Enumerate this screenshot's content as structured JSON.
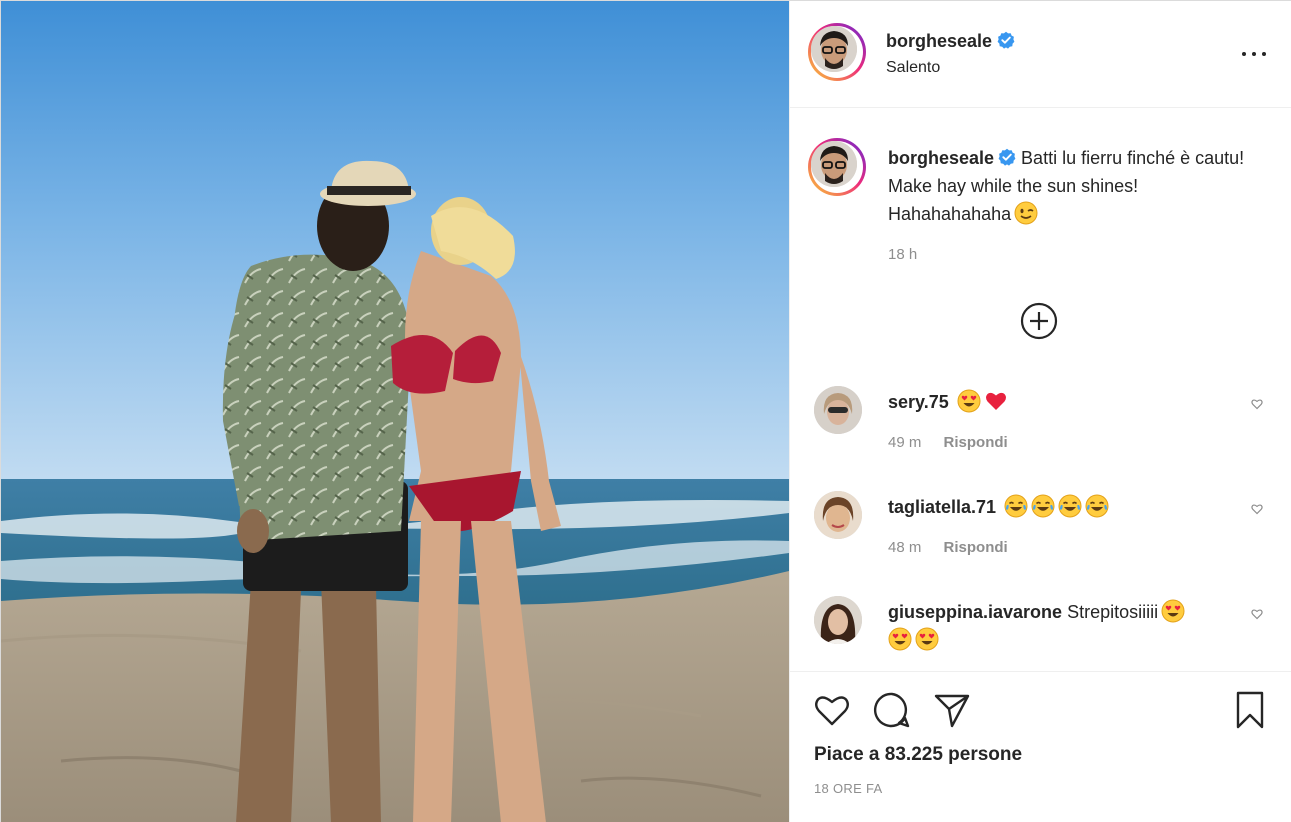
{
  "post": {
    "author": {
      "username": "borgheseale",
      "location": "Salento",
      "verified_icon": "verified-badge-icon"
    },
    "caption": {
      "text": "Batti lu fierru finché è cautu! Make hay while the sun shines! Hahahahahaha",
      "emoji": "winking-face",
      "time": "18 h"
    },
    "load_more_icon": "plus-circle-icon",
    "comments": [
      {
        "username": "sery.75",
        "text": "",
        "emojis": [
          "heart-eyes",
          "red-heart"
        ],
        "time": "49 m",
        "reply_label": "Rispondi"
      },
      {
        "username": "tagliatella.71",
        "text": "",
        "emojis": [
          "tears-of-joy",
          "tears-of-joy",
          "tears-of-joy",
          "tears-of-joy"
        ],
        "time": "48 m",
        "reply_label": "Rispondi"
      },
      {
        "username": "giuseppina.iavarone",
        "text": "Strepitosiiiii",
        "emojis": [
          "heart-eyes",
          "heart-eyes",
          "heart-eyes"
        ]
      }
    ],
    "actions": {
      "like_icon": "heart-outline-icon",
      "comment_icon": "speech-bubble-icon",
      "share_icon": "paper-plane-icon",
      "save_icon": "bookmark-icon"
    },
    "likes_text": "Piace a 83.225 persone",
    "date": "18 ORE FA"
  },
  "colors": {
    "text": "#262626",
    "muted": "#8e8e8e",
    "border": "#efefef",
    "verified": "#3897f0",
    "ring_gradient": [
      "#f9ce34",
      "#ee2a7b",
      "#6228d7"
    ]
  }
}
